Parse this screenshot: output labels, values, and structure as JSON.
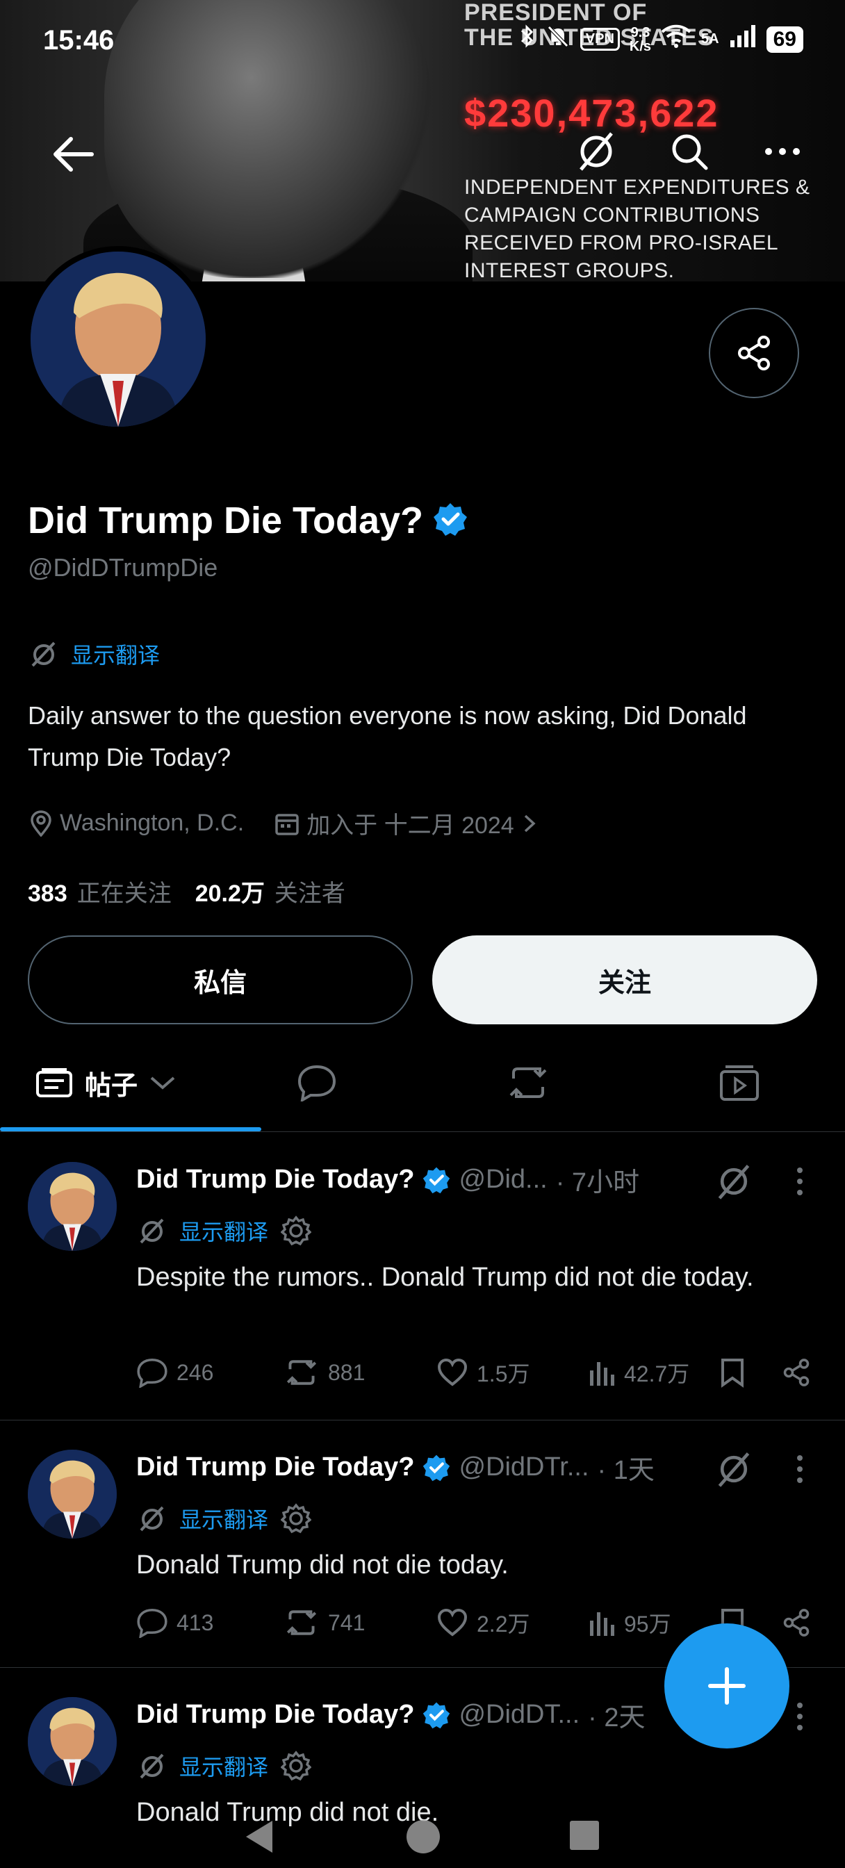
{
  "banner": {
    "headline": "PRESIDENT OF\nTHE UNITED STATES",
    "amount": "$230,473,622",
    "description": "INDEPENDENT EXPENDITURES &\nCAMPAIGN CONTRIBUTIONS\nRECEIVED FROM PRO-ISRAEL\nINTEREST GROUPS."
  },
  "status_bar": {
    "time": "15:46",
    "vpn": "VPN",
    "speed_value": "9.3",
    "speed_unit": "K/s",
    "network": "5A",
    "battery": "69"
  },
  "profile": {
    "name": "Did Trump Die Today?",
    "handle": "@DidDTrumpDie",
    "translate_label": "显示翻译",
    "bio": "Daily answer to the question everyone is now asking, Did Donald Trump Die Today?",
    "location": "Washington, D.C.",
    "joined": "加入于 十二月 2024",
    "following_count": "383",
    "following_label": "正在关注",
    "followers_count": "20.2万",
    "followers_label": "关注者"
  },
  "buttons": {
    "dm": "私信",
    "follow": "关注"
  },
  "tabs": {
    "posts": "帖子"
  },
  "posts": [
    {
      "name": "Did Trump Die Today?",
      "handle": "@Did...",
      "time": "· 7小时",
      "translate": "显示翻译",
      "text": "Despite the rumors.. Donald Trump did not die today.",
      "replies": "246",
      "reposts": "881",
      "likes": "1.5万",
      "views": "42.7万"
    },
    {
      "name": "Did Trump Die Today?",
      "handle": "@DidDTr...",
      "time": "· 1天",
      "translate": "显示翻译",
      "text": "Donald Trump did not die today.",
      "replies": "413",
      "reposts": "741",
      "likes": "2.2万",
      "views": "95万"
    },
    {
      "name": "Did Trump Die Today?",
      "handle": "@DidDT...",
      "time": "· 2天",
      "translate": "显示翻译",
      "text": "Donald Trump did not die."
    }
  ],
  "colors": {
    "accent": "#1d9bf0",
    "background": "#000000",
    "muted": "#71767b"
  }
}
